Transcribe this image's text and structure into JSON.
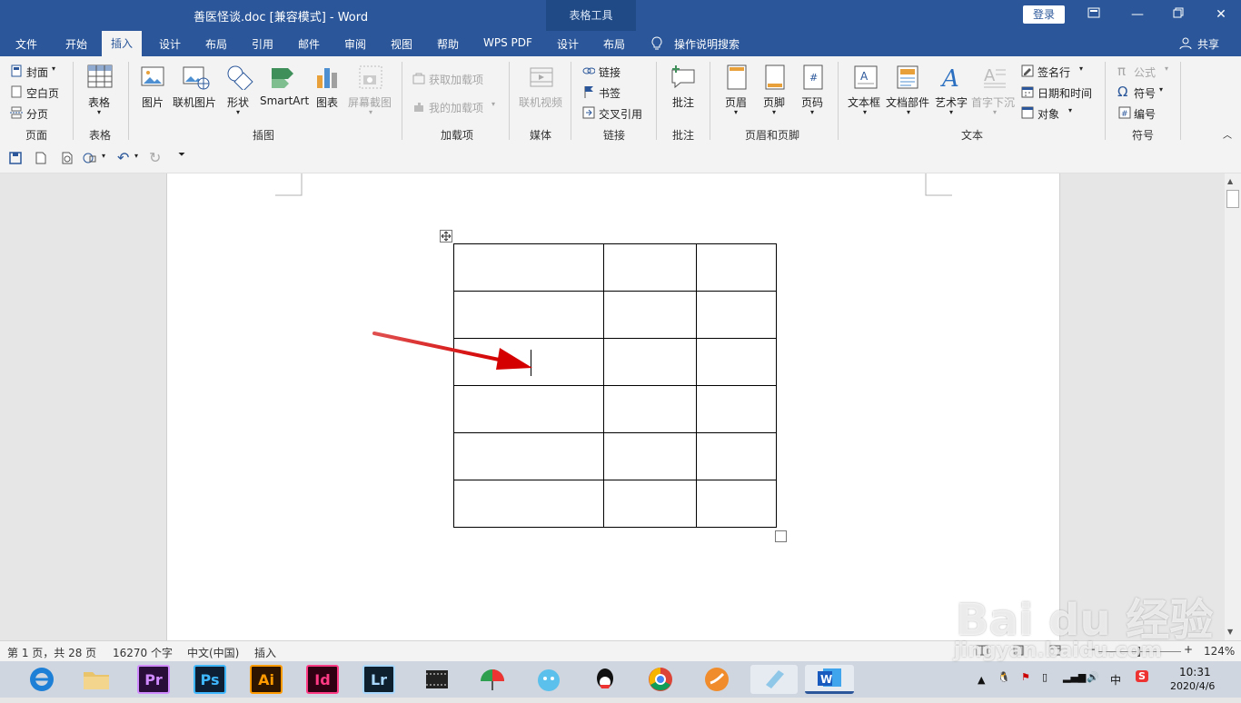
{
  "window": {
    "title": "善医怪谈.doc [兼容模式]  -  Word",
    "table_tools_label": "表格工具",
    "login_label": "登录",
    "share_label": "共享"
  },
  "tabs": [
    "文件",
    "开始",
    "插入",
    "设计",
    "布局",
    "引用",
    "邮件",
    "审阅",
    "视图",
    "帮助",
    "WPS PDF",
    "设计",
    "布局"
  ],
  "tell_me": "操作说明搜索",
  "ribbon": {
    "page_group": {
      "cover": "封面",
      "blank_page": "空白页",
      "page_break": "分页",
      "label": "页面"
    },
    "table_group": {
      "table": "表格",
      "label": "表格"
    },
    "illustrations": {
      "picture": "图片",
      "online_picture": "联机图片",
      "shapes": "形状",
      "smartart": "SmartArt",
      "chart": "图表",
      "screenshot": "屏幕截图",
      "label": "插图"
    },
    "addins": {
      "get_addins": "获取加载项",
      "my_addins": "我的加载项",
      "label": "加载项"
    },
    "media": {
      "online_video": "联机视频",
      "label": "媒体"
    },
    "links": {
      "link": "链接",
      "bookmark": "书签",
      "cross_ref": "交叉引用",
      "label": "链接"
    },
    "comments": {
      "comment": "批注",
      "label": "批注"
    },
    "header_footer": {
      "header": "页眉",
      "footer": "页脚",
      "page_number": "页码",
      "label": "页眉和页脚"
    },
    "text": {
      "text_box": "文本框",
      "quick_parts": "文档部件",
      "wordart": "艺术字",
      "drop_cap": "首字下沉",
      "signature": "签名行",
      "date_time": "日期和时间",
      "object": "对象",
      "label": "文本"
    },
    "symbols": {
      "equation": "公式",
      "symbol": "符号",
      "number": "编号",
      "label": "符号"
    }
  },
  "table": {
    "rows": 6,
    "cols": 3
  },
  "status": {
    "page": "第 1 页，共 28 页",
    "words": "16270 个字",
    "language": "中文(中国)",
    "mode": "插入",
    "zoom": "124%"
  },
  "taskbar": {
    "apps": [
      "Pr",
      "Ps",
      "Ai",
      "Id",
      "Lr"
    ],
    "tray_lang": "中",
    "time": "10:31",
    "date": "2020/4/6"
  },
  "watermark": {
    "brand": "Bai du 经验",
    "url": "jingyan.baidu.com"
  }
}
